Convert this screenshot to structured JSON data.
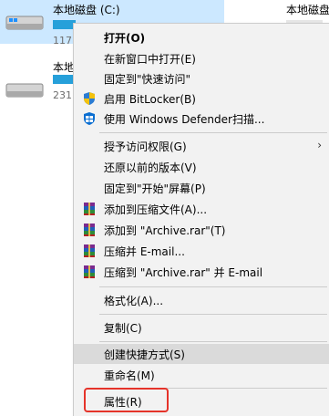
{
  "drives": [
    {
      "name": "本地磁盘 (C:)",
      "free": "117"
    },
    {
      "name": "本地磁盘",
      "free": "231"
    },
    {
      "name": "本地磁盘"
    }
  ],
  "menu": {
    "items": [
      {
        "label": "打开(O)"
      },
      {
        "label": "在新窗口中打开(E)"
      },
      {
        "label": "固定到\"快速访问\""
      },
      {
        "label": "启用 BitLocker(B)",
        "icon": "shield-uac-icon"
      },
      {
        "label": "使用 Windows Defender扫描...",
        "icon": "windows-defender-icon"
      },
      {
        "label": "授予访问权限(G)"
      },
      {
        "label": "还原以前的版本(V)"
      },
      {
        "label": "固定到\"开始\"屏幕(P)"
      },
      {
        "label": "添加到压缩文件(A)...",
        "icon": "winrar-icon"
      },
      {
        "label": "添加到 \"Archive.rar\"(T)",
        "icon": "winrar-icon"
      },
      {
        "label": "压缩并 E-mail...",
        "icon": "winrar-icon"
      },
      {
        "label": "压缩到 \"Archive.rar\" 并 E-mail",
        "icon": "winrar-icon"
      },
      {
        "label": "格式化(A)..."
      },
      {
        "label": "复制(C)"
      },
      {
        "label": "创建快捷方式(S)"
      },
      {
        "label": "重命名(M)"
      },
      {
        "label": "属性(R)"
      }
    ],
    "submenu_arrow": "›"
  },
  "colors": {
    "selection": "#cce8ff",
    "usage_bar": "#26a0da",
    "menu_bg": "#f2f2f2",
    "hover": "#dadada",
    "annotation": "#e5332a"
  }
}
